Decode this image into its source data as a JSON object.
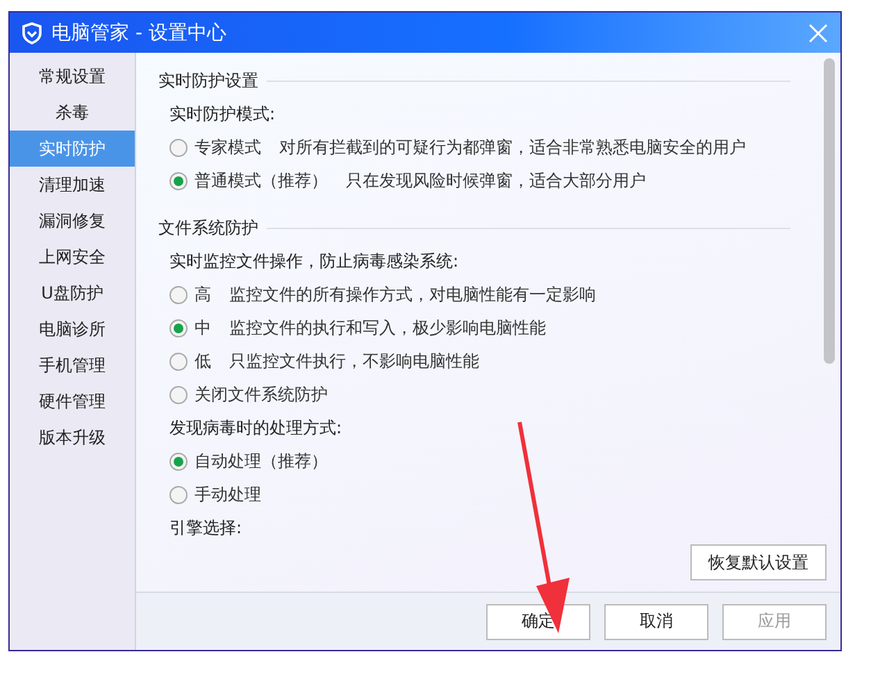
{
  "window": {
    "title": "电脑管家 - 设置中心"
  },
  "sidebar": {
    "items": [
      {
        "label": "常规设置",
        "selected": false
      },
      {
        "label": "杀毒",
        "selected": false
      },
      {
        "label": "实时防护",
        "selected": true
      },
      {
        "label": "清理加速",
        "selected": false
      },
      {
        "label": "漏洞修复",
        "selected": false
      },
      {
        "label": "上网安全",
        "selected": false
      },
      {
        "label": "U盘防护",
        "selected": false
      },
      {
        "label": "电脑诊所",
        "selected": false
      },
      {
        "label": "手机管理",
        "selected": false
      },
      {
        "label": "硬件管理",
        "selected": false
      },
      {
        "label": "版本升级",
        "selected": false
      }
    ]
  },
  "sections": [
    {
      "title": "实时防护设置",
      "groups": [
        {
          "label": "实时防护模式:",
          "options": [
            {
              "name": "专家模式",
              "desc": "对所有拦截到的可疑行为都弹窗，适合非常熟悉电脑安全的用户",
              "selected": false
            },
            {
              "name": "普通模式（推荐）",
              "desc": "只在发现风险时候弹窗，适合大部分用户",
              "selected": true
            }
          ]
        }
      ]
    },
    {
      "title": "文件系统防护",
      "groups": [
        {
          "label": "实时监控文件操作，防止病毒感染系统:",
          "options": [
            {
              "name": "高",
              "desc": "监控文件的所有操作方式，对电脑性能有一定影响",
              "selected": false
            },
            {
              "name": "中",
              "desc": "监控文件的执行和写入，极少影响电脑性能",
              "selected": true
            },
            {
              "name": "低",
              "desc": "只监控文件执行，不影响电脑性能",
              "selected": false
            },
            {
              "name": "关闭文件系统防护",
              "selected": false
            }
          ]
        },
        {
          "label": "发现病毒时的处理方式:",
          "options": [
            {
              "name": "自动处理（推荐）",
              "selected": true
            },
            {
              "name": "手动处理",
              "selected": false
            }
          ]
        },
        {
          "label": "引擎选择:"
        }
      ]
    }
  ],
  "restore_button": "恢复默认设置",
  "buttons": [
    {
      "label": "确定",
      "disabled": false
    },
    {
      "label": "取消",
      "disabled": false
    },
    {
      "label": "应用",
      "disabled": true
    }
  ]
}
